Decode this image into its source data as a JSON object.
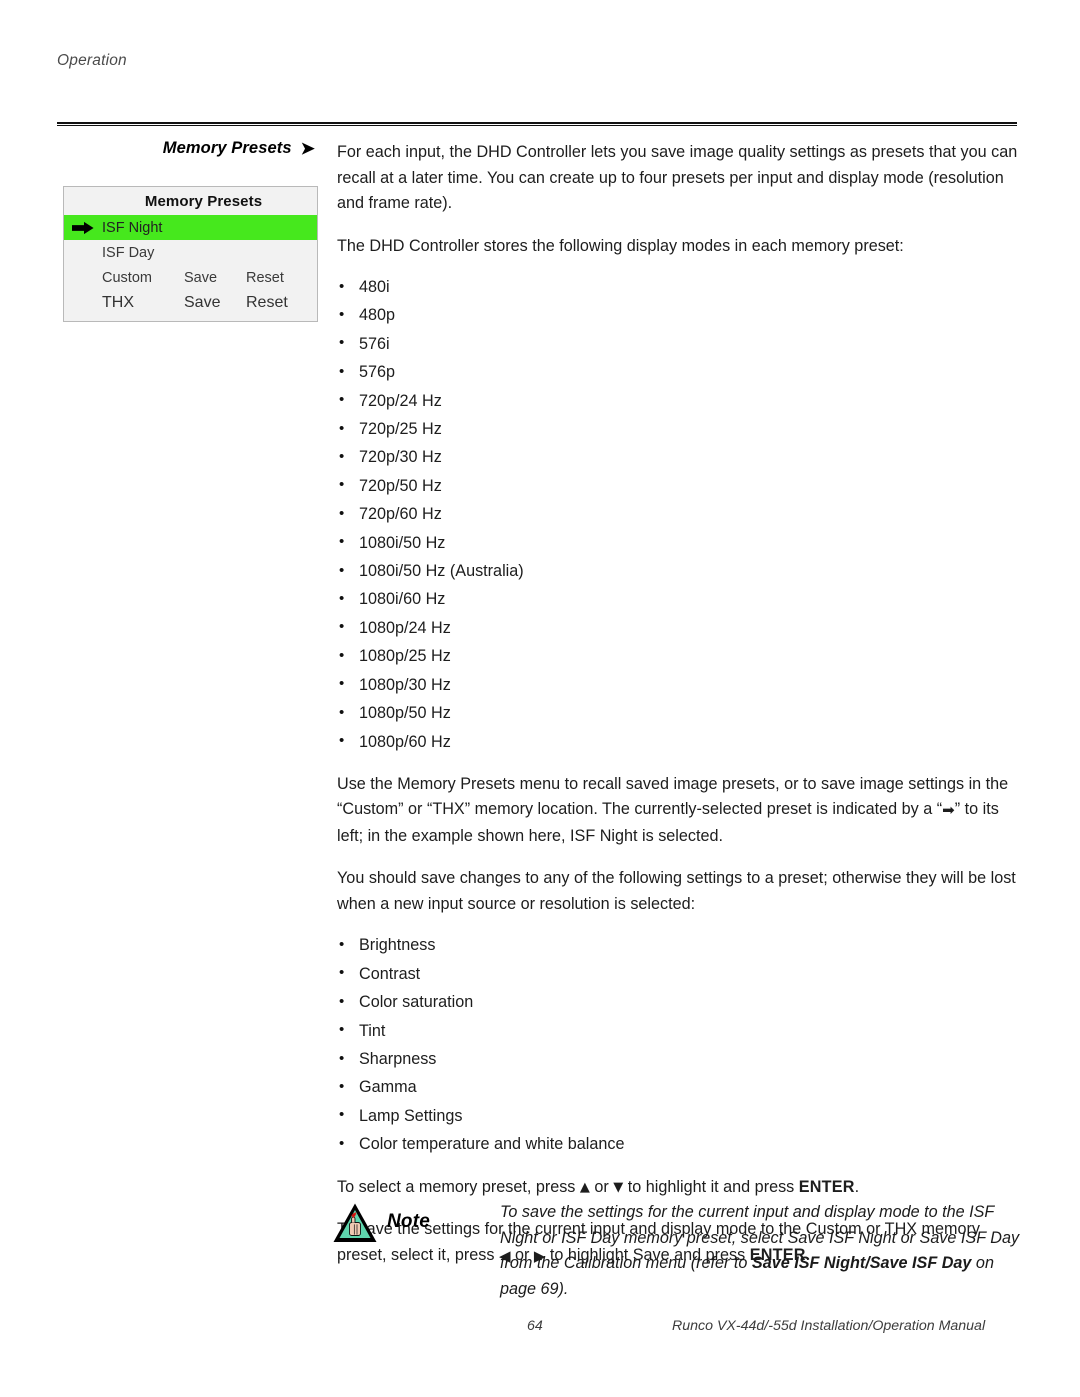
{
  "header": {
    "running_head": "Operation"
  },
  "margin": {
    "heading": "Memory Presets",
    "heading_arrow": "➤"
  },
  "osd_menu": {
    "title": "Memory Presets",
    "selected_index": 0,
    "highlight_color": "#46E81D",
    "background_color": "#F2F2F2",
    "rows": [
      {
        "label": "ISF Night",
        "save": "",
        "reset": "",
        "selected": true
      },
      {
        "label": "ISF Day",
        "save": "",
        "reset": "",
        "selected": false
      },
      {
        "label": "Custom",
        "save": "Save",
        "reset": "Reset",
        "selected": false
      },
      {
        "label": "THX",
        "save": "Save",
        "reset": "Reset",
        "selected": false
      }
    ]
  },
  "body": {
    "intro_paragraph": "For each input, the DHD Controller lets you save image quality settings as presets that you can recall at a later time. You can create up to four presets per input and display mode (resolution and frame rate).",
    "modes_lead": "The DHD Controller stores the following display modes in each memory preset:",
    "display_modes": [
      "480i",
      "480p",
      "576i",
      "576p",
      "720p/24 Hz",
      "720p/25 Hz",
      "720p/30 Hz",
      "720p/50 Hz",
      "720p/60 Hz",
      "1080i/50 Hz",
      "1080i/50 Hz (Australia)",
      "1080i/60 Hz",
      "1080p/24 Hz",
      "1080p/25 Hz",
      "1080p/30 Hz",
      "1080p/50 Hz",
      "1080p/60 Hz"
    ],
    "usage_paragraph_part1": "Use the Memory Presets menu to recall saved image presets, or to save image settings in the “Custom” or “THX” memory location. The currently-selected preset is indicated by a “",
    "usage_paragraph_arrow": "➡",
    "usage_paragraph_part2": "” to its left; in the example shown here, ISF Night is selected.",
    "settings_lead": "You should save changes to any of the following settings to a preset; otherwise they will be lost when a new input source or resolution is selected:",
    "settings_list": [
      "Brightness",
      "Contrast",
      "Color saturation",
      "Tint",
      "Sharpness",
      "Gamma",
      "Lamp Settings",
      "Color temperature and white balance"
    ],
    "select_preset_part1": "To select a memory preset, press ",
    "select_preset_up": "▲",
    "select_preset_mid": " or ",
    "select_preset_down": "▼",
    "select_preset_part2": " to highlight it and press ",
    "select_preset_enter": "ENTER",
    "select_preset_end": ".",
    "save_preset_part1": "To save the settings for the current input and display mode to the Custom or THX memory preset, select it, press ",
    "save_preset_left": "◀",
    "save_preset_mid": " or ",
    "save_preset_right": "▶",
    "save_preset_part2": " to highlight Save and press ",
    "save_preset_enter": "ENTER",
    "save_preset_end": "."
  },
  "note": {
    "label": "Note",
    "icon": "note-triangle-hand-reminder-icon",
    "text_part1": "To save the settings for the current input and display mode to the ISF Night or ISF Day memory preset, select Save ISF Night or Save ISF Day from the Calibration menu (refer to ",
    "text_bold": "Save ISF Night/Save ISF Day",
    "text_part2": " on page 69)."
  },
  "footer": {
    "page_number": "64",
    "manual_title": "Runco VX-44d/-55d Installation/Operation Manual"
  }
}
